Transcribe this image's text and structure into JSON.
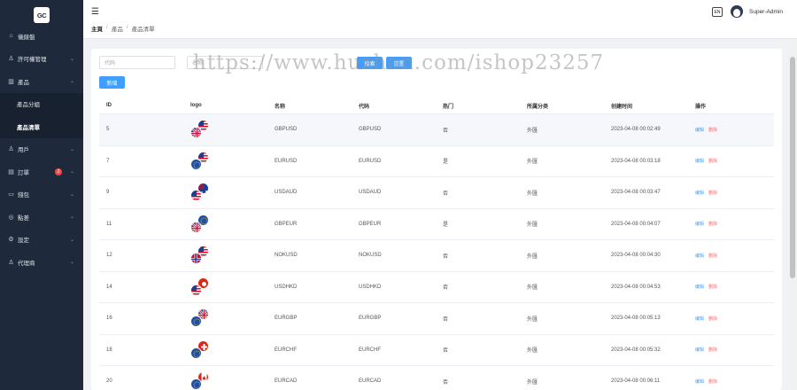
{
  "logo": {
    "text": "GC"
  },
  "sidebar": {
    "items": [
      {
        "label": "儀錶盤",
        "icon": "home-icon",
        "chevron": false
      },
      {
        "label": "許可權管理",
        "icon": "user-group-icon",
        "chevron": true
      },
      {
        "label": "產品",
        "icon": "chart-icon",
        "chevron": true
      },
      {
        "label": "產品分組",
        "sub": true
      },
      {
        "label": "產品清單",
        "sub": true,
        "active": true
      },
      {
        "label": "用戶",
        "icon": "user-icon",
        "chevron": true
      },
      {
        "label": "訂單",
        "icon": "order-icon",
        "chevron": true,
        "badge": "2"
      },
      {
        "label": "錢包",
        "icon": "wallet-icon",
        "chevron": true
      },
      {
        "label": "點差",
        "icon": "spread-icon",
        "chevron": true
      },
      {
        "label": "設定",
        "icon": "settings-icon",
        "chevron": true
      },
      {
        "label": "代理商",
        "icon": "agent-icon",
        "chevron": true
      }
    ]
  },
  "header": {
    "breadcrumb": [
      "主頁",
      "產品",
      "產品清單"
    ],
    "lang": "EN",
    "username": "Super-Admin"
  },
  "toolbar": {
    "search_placeholder": "代码",
    "search2_placeholder": "名称",
    "search_label": "搜索",
    "reset_label": "重置",
    "add_label": "新增"
  },
  "watermark": "https://www.huzhan.com/ishop23257",
  "table": {
    "columns": [
      "ID",
      "logo",
      "名称",
      "代码",
      "热门",
      "所属分类",
      "创建时间",
      "操作"
    ],
    "edit_label": "编辑",
    "delete_label": "删除",
    "rows": [
      {
        "id": "5",
        "name": "GBPUSD",
        "code": "GBPUSD",
        "hot": "否",
        "cat": "外匯",
        "time": "2023-04-08 00:02:49",
        "flags": [
          "uk",
          "us"
        ]
      },
      {
        "id": "7",
        "name": "EURUSD",
        "code": "EURUSD",
        "hot": "是",
        "cat": "外匯",
        "time": "2023-04-08 00:03:18",
        "flags": [
          "eu",
          "us"
        ]
      },
      {
        "id": "9",
        "name": "USDAUD",
        "code": "USDAUD",
        "hot": "否",
        "cat": "外匯",
        "time": "2023-04-08 00:03:47",
        "flags": [
          "us",
          "au"
        ]
      },
      {
        "id": "11",
        "name": "GBPEUR",
        "code": "GBPEUR",
        "hot": "是",
        "cat": "外匯",
        "time": "2023-04-08 00:04:07",
        "flags": [
          "uk",
          "eu"
        ]
      },
      {
        "id": "12",
        "name": "NOKUSD",
        "code": "NOKUSD",
        "hot": "否",
        "cat": "外匯",
        "time": "2023-04-08 00:04:30",
        "flags": [
          "no",
          "us"
        ]
      },
      {
        "id": "14",
        "name": "USDHKD",
        "code": "USDHKD",
        "hot": "否",
        "cat": "外匯",
        "time": "2023-04-08 00:04:53",
        "flags": [
          "us",
          "hk"
        ]
      },
      {
        "id": "16",
        "name": "EURGBP",
        "code": "EURGBP",
        "hot": "否",
        "cat": "外匯",
        "time": "2023-04-08 00:05:13",
        "flags": [
          "eu",
          "uk"
        ]
      },
      {
        "id": "18",
        "name": "EURCHF",
        "code": "EURCHF",
        "hot": "否",
        "cat": "外匯",
        "time": "2023-04-08 00:05:32",
        "flags": [
          "eu",
          "ch"
        ]
      },
      {
        "id": "20",
        "name": "EURCAD",
        "code": "EURCAD",
        "hot": "否",
        "cat": "外匯",
        "time": "2023-04-08 00:06:11",
        "flags": [
          "eu",
          "ca"
        ]
      }
    ]
  }
}
